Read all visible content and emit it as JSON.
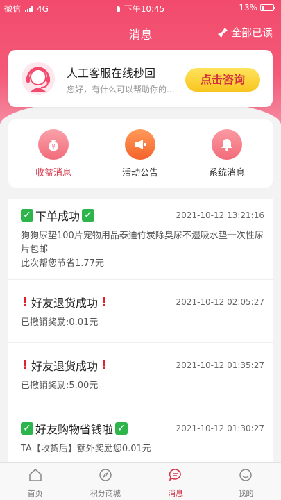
{
  "status": {
    "carrier": "微信",
    "network": "4G",
    "time": "下午10:45",
    "battery": "13%"
  },
  "header": {
    "title": "消息",
    "read_all": "全部已读"
  },
  "service": {
    "title": "人工客服在线秒回",
    "subtitle": "您好，有什么可以帮助你的...",
    "button": "点击咨询"
  },
  "categories": [
    {
      "label": "收益消息",
      "icon": "moneybag-icon"
    },
    {
      "label": "活动公告",
      "icon": "megaphone-icon"
    },
    {
      "label": "系统消息",
      "icon": "bell-icon"
    }
  ],
  "messages": [
    {
      "title": "下单成功",
      "time": "2021-10-12 13:21:16",
      "line1": "狗狗尿垫100片宠物用品泰迪竹炭除臭尿不湿吸水垫一次性尿片包邮",
      "line2": "此次帮您节省1.77元"
    },
    {
      "title": "好友退货成功",
      "time": "2021-10-12 02:05:27",
      "line1": "已撤销奖励:0.01元"
    },
    {
      "title": "好友退货成功",
      "time": "2021-10-12 01:35:27",
      "line1": "已撤销奖励:5.00元"
    },
    {
      "title": "好友购物省钱啦",
      "time": "2021-10-12 01:30:27",
      "line1": "TA【收货后】额外奖励您0.01元"
    }
  ],
  "tabs": [
    {
      "label": "首页"
    },
    {
      "label": "积分商城"
    },
    {
      "label": "消息"
    },
    {
      "label": "我的"
    }
  ],
  "colors": {
    "brand": "#f24a6c",
    "accent_red": "#d4374a",
    "button_yellow": "#f8c51f",
    "check_green": "#2db44a"
  }
}
